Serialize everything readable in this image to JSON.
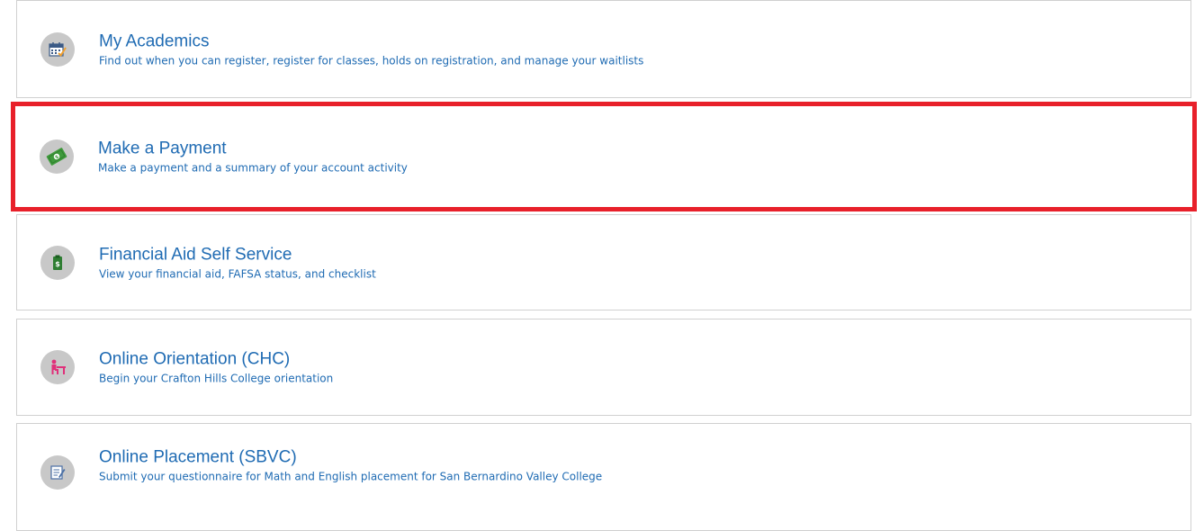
{
  "cards": [
    {
      "title": "My Academics",
      "description": "Find out when you can register, register for classes, holds on registration, and manage your waitlists",
      "icon": "calendar-icon",
      "highlighted": false
    },
    {
      "title": "Make a Payment",
      "description": "Make a payment and a summary of your account activity",
      "icon": "money-icon",
      "highlighted": true
    },
    {
      "title": "Financial Aid Self Service",
      "description": "View your financial aid, FAFSA status, and checklist",
      "icon": "financial-aid-icon",
      "highlighted": false
    },
    {
      "title": "Online Orientation (CHC)",
      "description": "Begin your Crafton Hills College orientation",
      "icon": "student-desk-icon",
      "highlighted": false
    },
    {
      "title": "Online Placement (SBVC)",
      "description": "Submit your questionnaire for Math and English placement for San Bernardino Valley College",
      "icon": "questionnaire-icon",
      "highlighted": false
    }
  ],
  "colors": {
    "link_blue": "#1f6bb3",
    "highlight_red": "#e8202a",
    "icon_circle": "#c8c8c8",
    "card_border": "#d0d0d0"
  }
}
